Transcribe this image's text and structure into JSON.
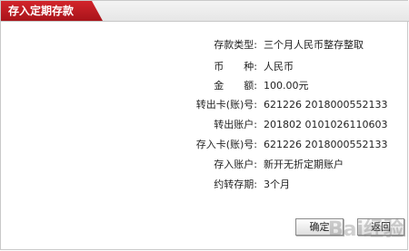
{
  "tab_title": "存入定期存款",
  "fields": [
    {
      "label": "存款类型:",
      "value": "三个月人民币整存整取"
    },
    {
      "label": "币　　种:",
      "value": "人民币"
    },
    {
      "label": "金　　额:",
      "value": "100.00元"
    },
    {
      "label": "转出卡(账)号:",
      "value": "621226 2018000552133"
    },
    {
      "label": "转出账户:",
      "value": "201802 0101026110603"
    },
    {
      "label": "存入卡(账)号:",
      "value": "621226 2018000552133"
    },
    {
      "label": "存入账户:",
      "value": "新开无折定期账户"
    },
    {
      "label": "约转存期:",
      "value": "3个月"
    }
  ],
  "buttons": {
    "confirm": "确定",
    "back": "返回"
  },
  "watermark": "Bai经验"
}
